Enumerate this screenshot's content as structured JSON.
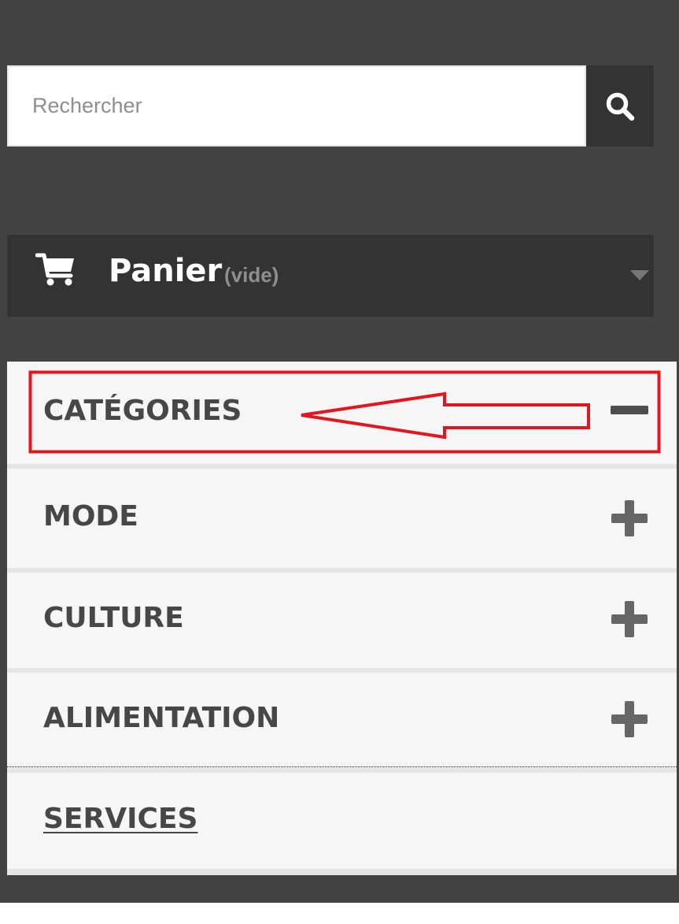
{
  "search": {
    "placeholder": "Rechercher",
    "button_icon": "search-icon"
  },
  "cart": {
    "icon": "cart-icon",
    "title": "Panier",
    "status": "(vide)",
    "expand_icon": "caret-down-icon"
  },
  "categories": {
    "header": {
      "label": "CATÉGORIES",
      "toggle_icon": "minus-icon"
    },
    "items": [
      {
        "label": "MODE",
        "toggle_icon": "plus-icon"
      },
      {
        "label": "CULTURE",
        "toggle_icon": "plus-icon"
      },
      {
        "label": "ALIMENTATION",
        "toggle_icon": "plus-icon"
      },
      {
        "label": "SERVICES"
      }
    ]
  },
  "annotation": {
    "highlight_color": "#e3161f",
    "arrow_icon": "arrow-left-icon"
  },
  "colors": {
    "page_background": "#434343",
    "dark_bar": "#333333",
    "panel_background": "#f6f6f6",
    "label_text": "#474747",
    "toggle_icon": "#666666"
  }
}
